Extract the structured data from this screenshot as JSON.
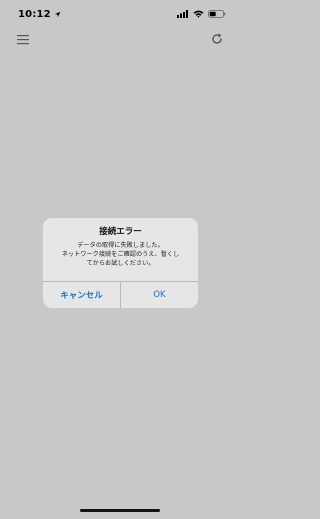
{
  "status_bar": {
    "time": "10:12",
    "icons": [
      "location-arrow-icon",
      "signal-icon",
      "wifi-icon",
      "battery-icon"
    ]
  },
  "toolbar": {
    "icons": [
      "hamburger-menu-icon",
      "refresh-icon"
    ]
  },
  "dialog": {
    "title": "接続エラー",
    "message": "データの取得に失敗しました。\nネットワーク接続をご確認のうえ、暫くし\nてからお試しください。",
    "cancel_label": "キャンセル",
    "ok_label": "OK",
    "accent_color": "#1a73c9"
  },
  "colors": {
    "background": "#c8c8c8",
    "dialog_background": "#e6e6e6"
  }
}
